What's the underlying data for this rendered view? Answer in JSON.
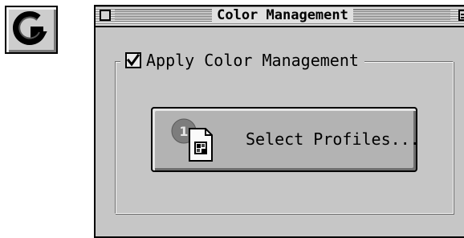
{
  "app_icon": {
    "icon": "color-management-app-icon"
  },
  "window": {
    "title": "Color Management",
    "close_box_icon": "close-box-icon",
    "collapse_box_icon": "collapse-box-icon"
  },
  "group": {
    "checkbox_checked": true,
    "checkbox_label": "Apply Color Management"
  },
  "select_profiles_button": {
    "label": "Select Profiles...",
    "icon": "profile-document-icon",
    "badge_number": "1"
  }
}
